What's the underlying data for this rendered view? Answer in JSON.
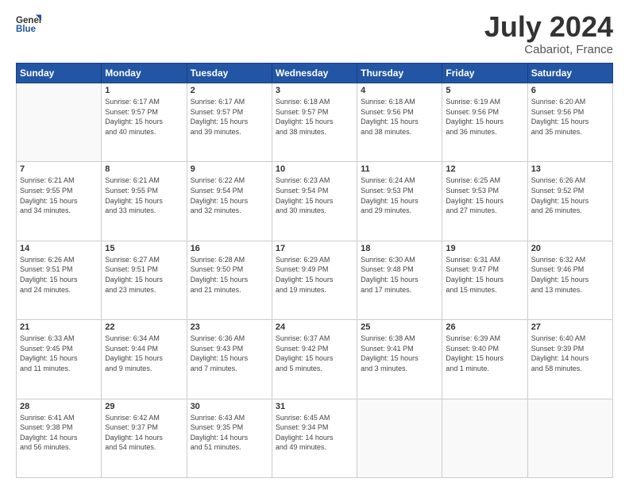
{
  "header": {
    "logo_line1": "General",
    "logo_line2": "Blue",
    "month_year": "July 2024",
    "location": "Cabariot, France"
  },
  "days_of_week": [
    "Sunday",
    "Monday",
    "Tuesday",
    "Wednesday",
    "Thursday",
    "Friday",
    "Saturday"
  ],
  "weeks": [
    [
      {
        "day": "",
        "info": ""
      },
      {
        "day": "1",
        "info": "Sunrise: 6:17 AM\nSunset: 9:57 PM\nDaylight: 15 hours\nand 40 minutes."
      },
      {
        "day": "2",
        "info": "Sunrise: 6:17 AM\nSunset: 9:57 PM\nDaylight: 15 hours\nand 39 minutes."
      },
      {
        "day": "3",
        "info": "Sunrise: 6:18 AM\nSunset: 9:57 PM\nDaylight: 15 hours\nand 38 minutes."
      },
      {
        "day": "4",
        "info": "Sunrise: 6:18 AM\nSunset: 9:56 PM\nDaylight: 15 hours\nand 38 minutes."
      },
      {
        "day": "5",
        "info": "Sunrise: 6:19 AM\nSunset: 9:56 PM\nDaylight: 15 hours\nand 36 minutes."
      },
      {
        "day": "6",
        "info": "Sunrise: 6:20 AM\nSunset: 9:56 PM\nDaylight: 15 hours\nand 35 minutes."
      }
    ],
    [
      {
        "day": "7",
        "info": "Sunrise: 6:21 AM\nSunset: 9:55 PM\nDaylight: 15 hours\nand 34 minutes."
      },
      {
        "day": "8",
        "info": "Sunrise: 6:21 AM\nSunset: 9:55 PM\nDaylight: 15 hours\nand 33 minutes."
      },
      {
        "day": "9",
        "info": "Sunrise: 6:22 AM\nSunset: 9:54 PM\nDaylight: 15 hours\nand 32 minutes."
      },
      {
        "day": "10",
        "info": "Sunrise: 6:23 AM\nSunset: 9:54 PM\nDaylight: 15 hours\nand 30 minutes."
      },
      {
        "day": "11",
        "info": "Sunrise: 6:24 AM\nSunset: 9:53 PM\nDaylight: 15 hours\nand 29 minutes."
      },
      {
        "day": "12",
        "info": "Sunrise: 6:25 AM\nSunset: 9:53 PM\nDaylight: 15 hours\nand 27 minutes."
      },
      {
        "day": "13",
        "info": "Sunrise: 6:26 AM\nSunset: 9:52 PM\nDaylight: 15 hours\nand 26 minutes."
      }
    ],
    [
      {
        "day": "14",
        "info": "Sunrise: 6:26 AM\nSunset: 9:51 PM\nDaylight: 15 hours\nand 24 minutes."
      },
      {
        "day": "15",
        "info": "Sunrise: 6:27 AM\nSunset: 9:51 PM\nDaylight: 15 hours\nand 23 minutes."
      },
      {
        "day": "16",
        "info": "Sunrise: 6:28 AM\nSunset: 9:50 PM\nDaylight: 15 hours\nand 21 minutes."
      },
      {
        "day": "17",
        "info": "Sunrise: 6:29 AM\nSunset: 9:49 PM\nDaylight: 15 hours\nand 19 minutes."
      },
      {
        "day": "18",
        "info": "Sunrise: 6:30 AM\nSunset: 9:48 PM\nDaylight: 15 hours\nand 17 minutes."
      },
      {
        "day": "19",
        "info": "Sunrise: 6:31 AM\nSunset: 9:47 PM\nDaylight: 15 hours\nand 15 minutes."
      },
      {
        "day": "20",
        "info": "Sunrise: 6:32 AM\nSunset: 9:46 PM\nDaylight: 15 hours\nand 13 minutes."
      }
    ],
    [
      {
        "day": "21",
        "info": "Sunrise: 6:33 AM\nSunset: 9:45 PM\nDaylight: 15 hours\nand 11 minutes."
      },
      {
        "day": "22",
        "info": "Sunrise: 6:34 AM\nSunset: 9:44 PM\nDaylight: 15 hours\nand 9 minutes."
      },
      {
        "day": "23",
        "info": "Sunrise: 6:36 AM\nSunset: 9:43 PM\nDaylight: 15 hours\nand 7 minutes."
      },
      {
        "day": "24",
        "info": "Sunrise: 6:37 AM\nSunset: 9:42 PM\nDaylight: 15 hours\nand 5 minutes."
      },
      {
        "day": "25",
        "info": "Sunrise: 6:38 AM\nSunset: 9:41 PM\nDaylight: 15 hours\nand 3 minutes."
      },
      {
        "day": "26",
        "info": "Sunrise: 6:39 AM\nSunset: 9:40 PM\nDaylight: 15 hours\nand 1 minute."
      },
      {
        "day": "27",
        "info": "Sunrise: 6:40 AM\nSunset: 9:39 PM\nDaylight: 14 hours\nand 58 minutes."
      }
    ],
    [
      {
        "day": "28",
        "info": "Sunrise: 6:41 AM\nSunset: 9:38 PM\nDaylight: 14 hours\nand 56 minutes."
      },
      {
        "day": "29",
        "info": "Sunrise: 6:42 AM\nSunset: 9:37 PM\nDaylight: 14 hours\nand 54 minutes."
      },
      {
        "day": "30",
        "info": "Sunrise: 6:43 AM\nSunset: 9:35 PM\nDaylight: 14 hours\nand 51 minutes."
      },
      {
        "day": "31",
        "info": "Sunrise: 6:45 AM\nSunset: 9:34 PM\nDaylight: 14 hours\nand 49 minutes."
      },
      {
        "day": "",
        "info": ""
      },
      {
        "day": "",
        "info": ""
      },
      {
        "day": "",
        "info": ""
      }
    ]
  ]
}
